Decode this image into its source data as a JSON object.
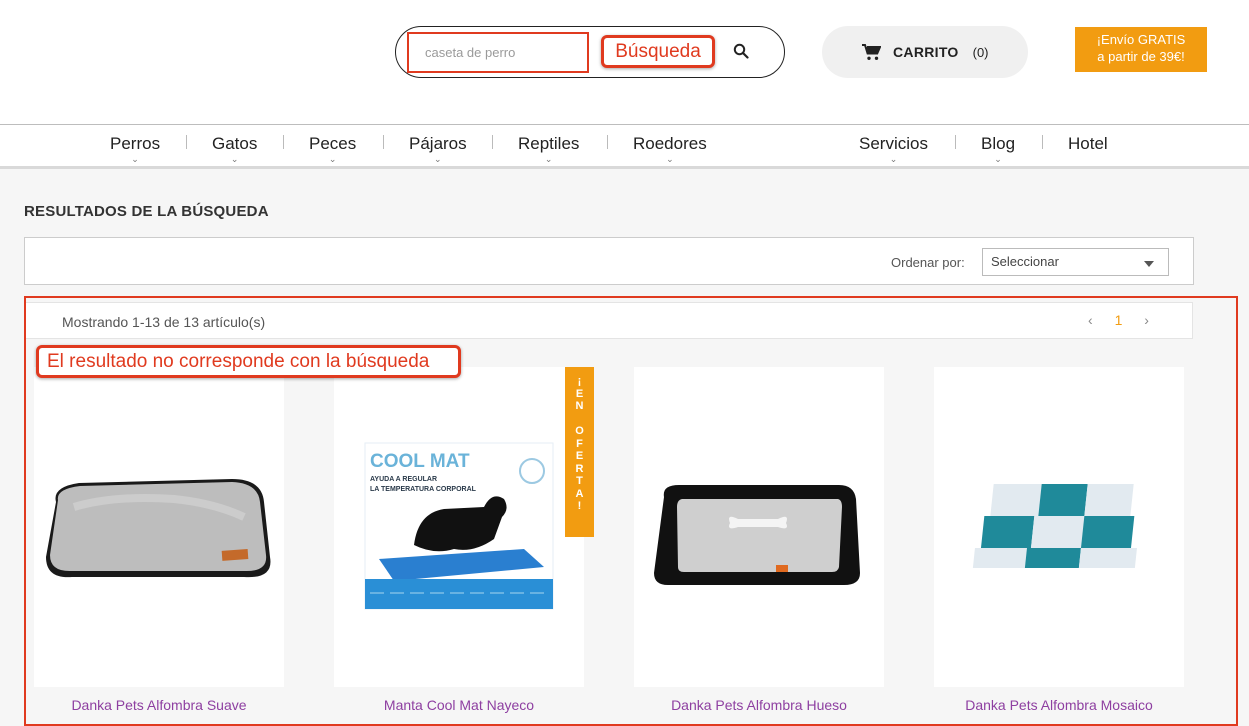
{
  "search": {
    "placeholder": "caseta de perro",
    "annotation": "Búsqueda"
  },
  "cart": {
    "label": "CARRITO",
    "count": "(0)"
  },
  "promo": {
    "line1": "¡Envío GRATIS",
    "line2": "a partir de 39€!"
  },
  "nav": [
    {
      "label": "Perros",
      "has_dropdown": true
    },
    {
      "label": "Gatos",
      "has_dropdown": true
    },
    {
      "label": "Peces",
      "has_dropdown": true
    },
    {
      "label": "Pájaros",
      "has_dropdown": true
    },
    {
      "label": "Reptiles",
      "has_dropdown": true
    },
    {
      "label": "Roedores",
      "has_dropdown": true
    },
    {
      "label": "Servicios",
      "has_dropdown": true
    },
    {
      "label": "Blog",
      "has_dropdown": true
    },
    {
      "label": "Hotel",
      "has_dropdown": false
    }
  ],
  "page": {
    "title": "RESULTADOS DE LA BÚSQUEDA"
  },
  "sort": {
    "label": "Ordenar por:",
    "value": "Seleccionar"
  },
  "results": {
    "count_text": "Mostrando 1-13 de 13 artículo(s)",
    "page": "1",
    "prev": "‹",
    "next": "›"
  },
  "annotation_result": "El resultado no corresponde con la búsqueda",
  "offer_badge": [
    "¡",
    "E",
    "N",
    "",
    "O",
    "F",
    "E",
    "R",
    "T",
    "A",
    "!"
  ],
  "cool_mat": {
    "title": "COOL MAT",
    "sub1": "AYUDA A REGULAR",
    "sub2": "LA TEMPERATURA CORPORAL"
  },
  "products": [
    {
      "name": "Danka Pets Alfombra Suave"
    },
    {
      "name": "Manta Cool Mat Nayeco"
    },
    {
      "name": "Danka Pets Alfombra Hueso"
    },
    {
      "name": "Danka Pets Alfombra Mosaico"
    }
  ],
  "colors": {
    "accent": "#f29c11",
    "annotation": "#e03a1f",
    "product_link": "#8e3fa1"
  }
}
